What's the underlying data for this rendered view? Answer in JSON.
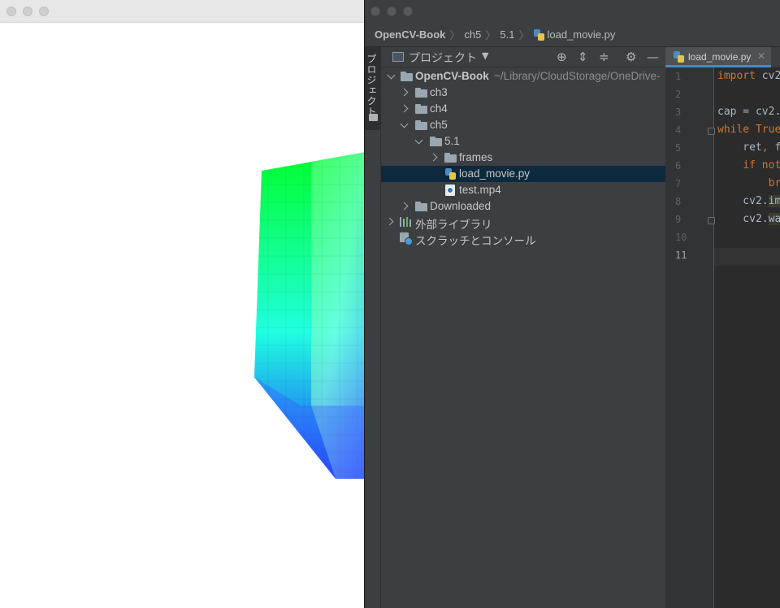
{
  "navbar": {
    "crumbs": [
      "OpenCV-Book",
      "ch5",
      "5.1",
      "load_movie.py"
    ]
  },
  "side_strip": {
    "label": "プロジェクト"
  },
  "project_panel": {
    "title": "プロジェクト",
    "tree": {
      "root": {
        "name": "OpenCV-Book",
        "path": "~/Library/CloudStorage/OneDrive-"
      },
      "ch3": "ch3",
      "ch4": "ch4",
      "ch5": "ch5",
      "sub": "5.1",
      "frames": "frames",
      "load_movie": "load_movie.py",
      "test_mp4": "test.mp4",
      "downloaded": "Downloaded",
      "external_libs": "外部ライブラリ",
      "scratches": "スクラッチとコンソール"
    }
  },
  "editor": {
    "tab_label": "load_movie.py",
    "line_numbers": [
      "1",
      "2",
      "3",
      "4",
      "5",
      "6",
      "7",
      "8",
      "9",
      "10",
      "11"
    ],
    "lines": {
      "l1a": "import",
      "l1b": " cv2",
      "l3": "cap = cv2.",
      "l4a": "while",
      "l4b": " True",
      "l5a": "    ret",
      "l5b": ",",
      "l5c": " f",
      "l6a": "    ",
      "l6b": "if",
      "l6c": " ",
      "l6d": "not",
      "l7a": "        ",
      "l7b": "br",
      "l8a": "    cv2.",
      "l8b": "im",
      "l9a": "    cv2.",
      "l9b": "wa"
    }
  },
  "colors": {
    "ide_bg": "#2b2b2b",
    "panel_bg": "#3c3f41",
    "selection": "#0d293e",
    "keyword": "#cc7832",
    "code_text": "#a9b7c6"
  }
}
